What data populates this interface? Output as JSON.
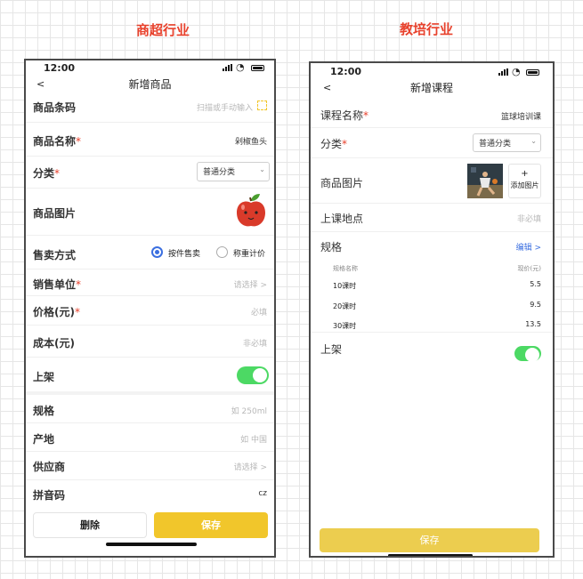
{
  "headings": {
    "retail": "商超行业",
    "education": "教培行业"
  },
  "left": {
    "status_time": "12:00",
    "back": "<",
    "title": "新增商品",
    "barcode": {
      "label": "商品条码",
      "placeholder": "扫描或手动输入"
    },
    "name": {
      "label": "商品名称",
      "value": "剁椒鱼头"
    },
    "category": {
      "label": "分类",
      "value": "普通分类"
    },
    "image": {
      "label": "商品图片"
    },
    "sale_mode": {
      "label": "售卖方式",
      "option1": "按件售卖",
      "option2": "称重计价",
      "selected": "按件售卖"
    },
    "unit": {
      "label": "销售单位",
      "placeholder": "请选择 >"
    },
    "price": {
      "label": "价格(元)",
      "placeholder": "必填"
    },
    "cost": {
      "label": "成本(元)",
      "placeholder": "非必填"
    },
    "shelf": {
      "label": "上架",
      "on": true
    },
    "spec": {
      "label": "规格",
      "placeholder": "如 250ml"
    },
    "origin": {
      "label": "产地",
      "placeholder": "如 中国"
    },
    "supplier": {
      "label": "供应商",
      "placeholder": "请选择 >"
    },
    "pinyin": {
      "label": "拼音码",
      "value": "cz"
    },
    "delete_btn": "删除",
    "save_btn": "保存"
  },
  "right": {
    "status_time": "12:00",
    "back": "<",
    "title": "新增课程",
    "course_name": {
      "label": "课程名称",
      "value": "篮球培训课"
    },
    "category": {
      "label": "分类",
      "value": "普通分类"
    },
    "image": {
      "label": "商品图片",
      "add_label": "添加图片",
      "add_plus": "+"
    },
    "location": {
      "label": "上课地点",
      "placeholder": "非必填"
    },
    "spec": {
      "label": "规格",
      "edit": "编辑 >"
    },
    "spec_table": {
      "headers": [
        "规格名称",
        "现价(元)"
      ],
      "rows": [
        {
          "name": "10课时",
          "price": "5.5"
        },
        {
          "name": "20课时",
          "price": "9.5"
        },
        {
          "name": "30课时",
          "price": "13.5"
        }
      ]
    },
    "shelf": {
      "label": "上架",
      "on": true
    },
    "save_btn": "保存"
  },
  "colors": {
    "accent_red": "#e8412c",
    "save_yellow": "#f1c62b",
    "toggle_green": "#4cd964",
    "radio_blue": "#3b6fe0",
    "link_blue": "#3b6fe0"
  }
}
